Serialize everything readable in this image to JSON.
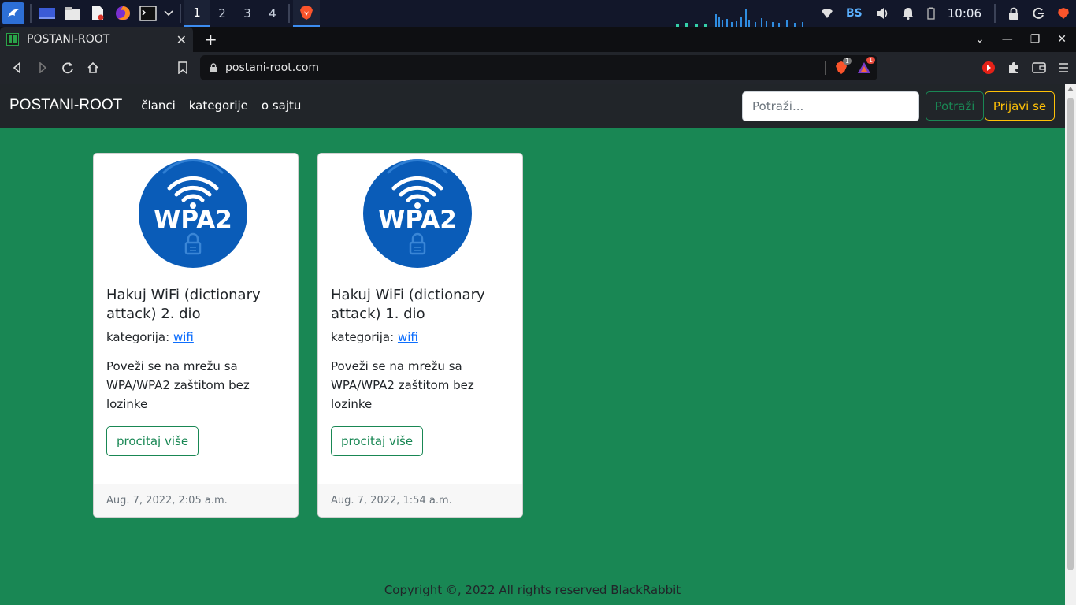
{
  "taskbar": {
    "workspaces": [
      "1",
      "2",
      "3",
      "4"
    ],
    "language": "BS",
    "clock": "10:06"
  },
  "browser": {
    "tab_title": "POSTANI-ROOT",
    "new_tab": "+",
    "url": "postani-root.com",
    "shield_count": "1",
    "alert_count": "1"
  },
  "navbar": {
    "brand": "POSTANI-ROOT",
    "links": [
      "članci",
      "kategorije",
      "o sajtu"
    ],
    "search_placeholder": "Potraži...",
    "search_button": "Potraži",
    "login_button": "Prijavi se"
  },
  "cards": [
    {
      "image_text": "WPA2",
      "title": "Hakuj WiFi (dictionary attack) 2. dio",
      "category_label": "kategorija:",
      "category": "wifi",
      "text": "Poveži se na mrežu sa WPA/WPA2 zaštitom bez lozinke",
      "button": "procitaj više",
      "date": "Aug. 7, 2022, 2:05 a.m."
    },
    {
      "image_text": "WPA2",
      "title": "Hakuj WiFi (dictionary attack) 1. dio",
      "category_label": "kategorija:",
      "category": "wifi",
      "text": "Poveži se na mrežu sa WPA/WPA2 zaštitom bez lozinke",
      "button": "procitaj više",
      "date": "Aug. 7, 2022, 1:54 a.m."
    }
  ],
  "footer": {
    "copyright": "Copyright ©, 2022 All rights reserved BlackRabbit"
  },
  "colors": {
    "page_bg": "#198754",
    "navbar_bg": "#212529",
    "wpa_blue": "#0a5cb8",
    "link": "#0d6efd",
    "warning": "#ffc107"
  }
}
